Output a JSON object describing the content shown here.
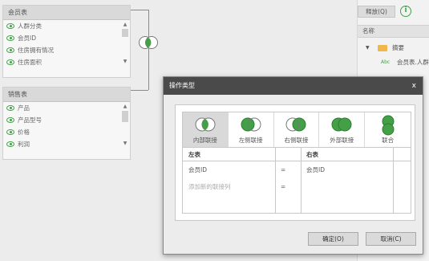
{
  "left_tables": [
    {
      "title": "会员表",
      "fields": [
        "人群分类",
        "会员ID",
        "住房拥有情况",
        "住房面积"
      ]
    },
    {
      "title": "销售表",
      "fields": [
        "产品",
        "产品型号",
        "价格",
        "利润"
      ]
    }
  ],
  "right_panel": {
    "filter_button": "释放(Q)",
    "header": "名称",
    "folder_label": "摘要",
    "item_badge": "Abc",
    "item_label": "会员表.人群"
  },
  "dialog": {
    "title": "操作类型",
    "close": "x",
    "join_types": [
      {
        "label": "内部联接",
        "icon": "inner-join-icon",
        "selected": true
      },
      {
        "label": "左侧联接",
        "icon": "left-join-icon",
        "selected": false
      },
      {
        "label": "右侧联接",
        "icon": "right-join-icon",
        "selected": false
      },
      {
        "label": "外部联接",
        "icon": "outer-join-icon",
        "selected": false
      },
      {
        "label": "联合",
        "icon": "union-icon",
        "selected": false
      }
    ],
    "grid": {
      "left_header": "左表",
      "right_header": "右表",
      "rows": [
        {
          "left": "会员ID",
          "op": "=",
          "right": "会员ID"
        },
        {
          "left": "添加新的联接列",
          "op": "=",
          "right": ""
        }
      ]
    },
    "ok_button": "确定(O)",
    "cancel_button": "取消(C)"
  },
  "colors": {
    "accent_green": "#43a047",
    "title_bar": "#4a4a4a"
  }
}
